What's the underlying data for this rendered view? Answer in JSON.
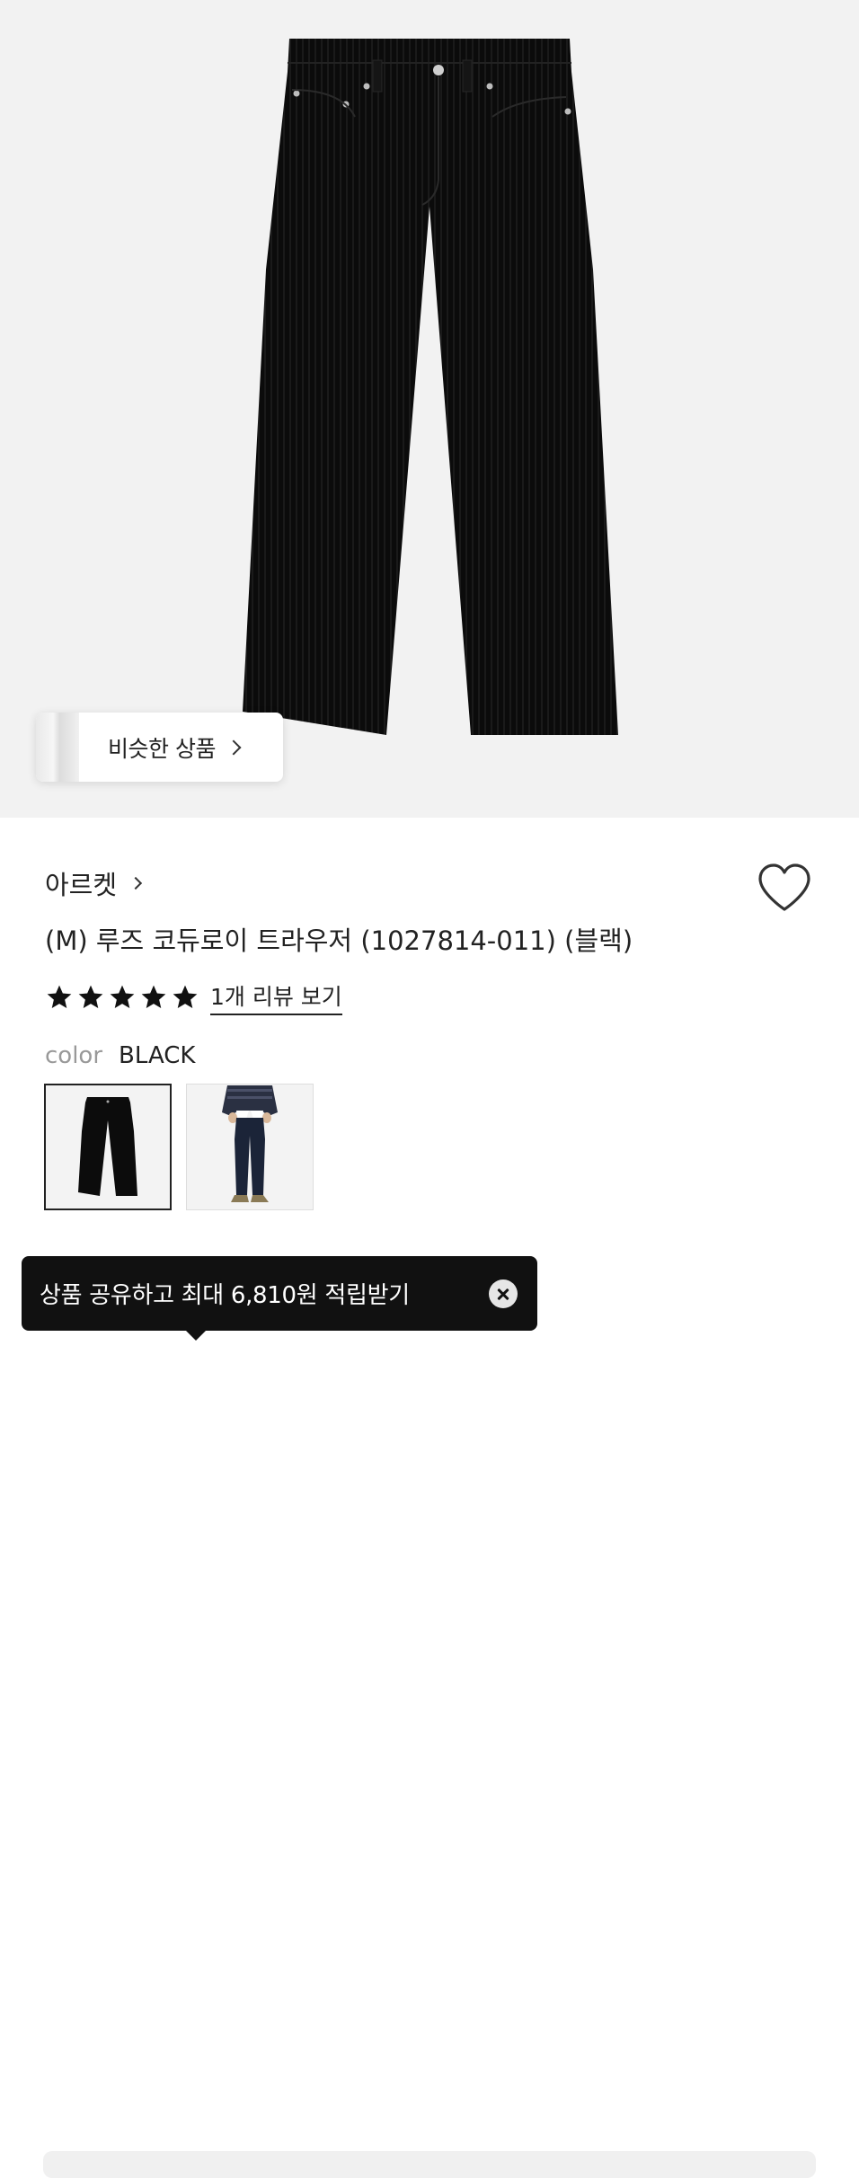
{
  "similar": {
    "label": "비슷한 상품"
  },
  "product": {
    "brand": "아르켓",
    "title": "(M) 루즈 코듀로이 트라우저 (1027814-011) (블랙)",
    "rating": 5,
    "rating_max": 5,
    "review_link": "1개 리뷰 보기",
    "color_key": "color",
    "color_value": "BLACK"
  },
  "swatches": [
    {
      "name": "black-corduroy",
      "selected": true
    },
    {
      "name": "navy-on-model",
      "selected": false
    }
  ],
  "toast": {
    "text": "상품 공유하고 최대 6,810원 적립받기"
  },
  "icons": {
    "similar_chevron": "chevron-right-icon",
    "brand_chevron": "chevron-right-icon",
    "wishlist": "heart-outline-icon",
    "rating": "star-icon",
    "close": "close-icon"
  },
  "colors": {
    "hero_bg": "#f2f2f2",
    "toast_bg": "#111111",
    "star": "#111111"
  }
}
